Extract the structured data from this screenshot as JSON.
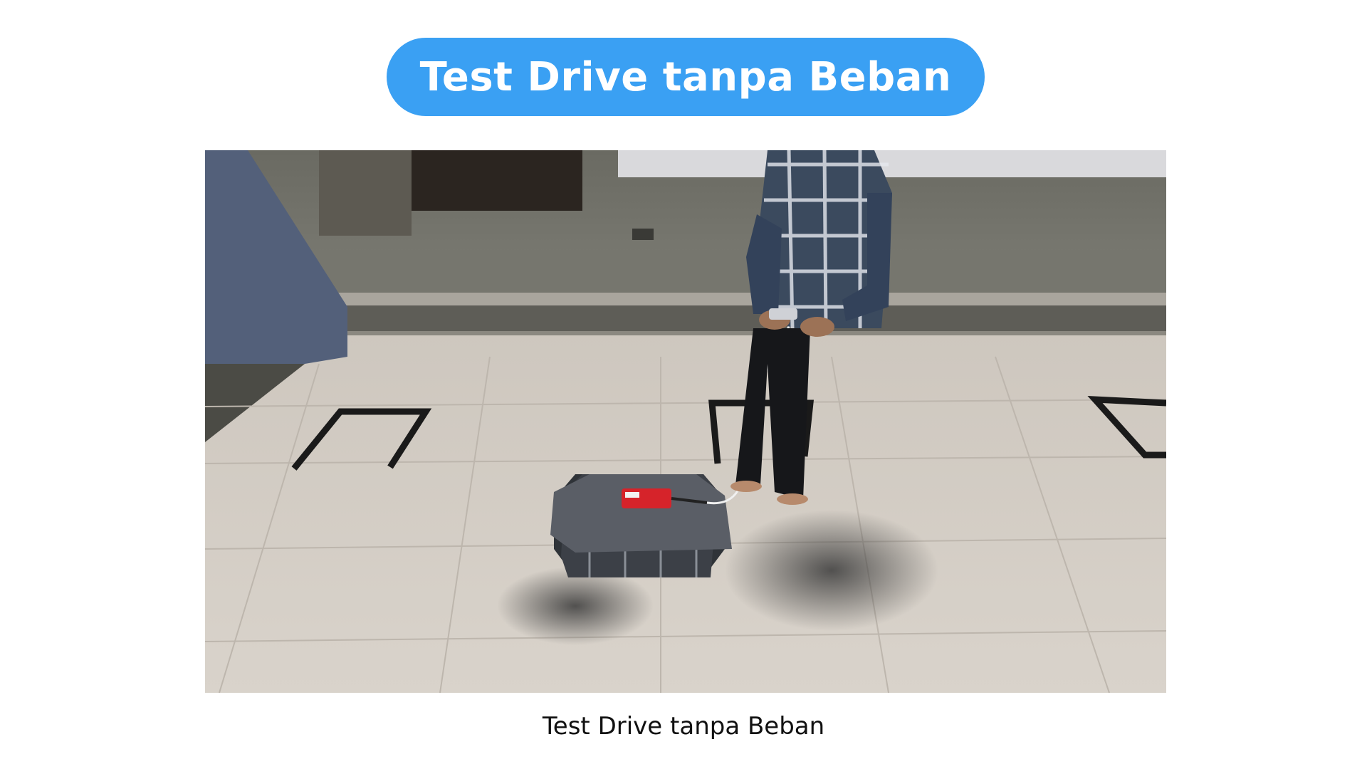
{
  "header": {
    "title": "Test Drive tanpa Beban",
    "accent_color": "#3aa0f3"
  },
  "media": {
    "caption": "Test Drive tanpa Beban"
  }
}
